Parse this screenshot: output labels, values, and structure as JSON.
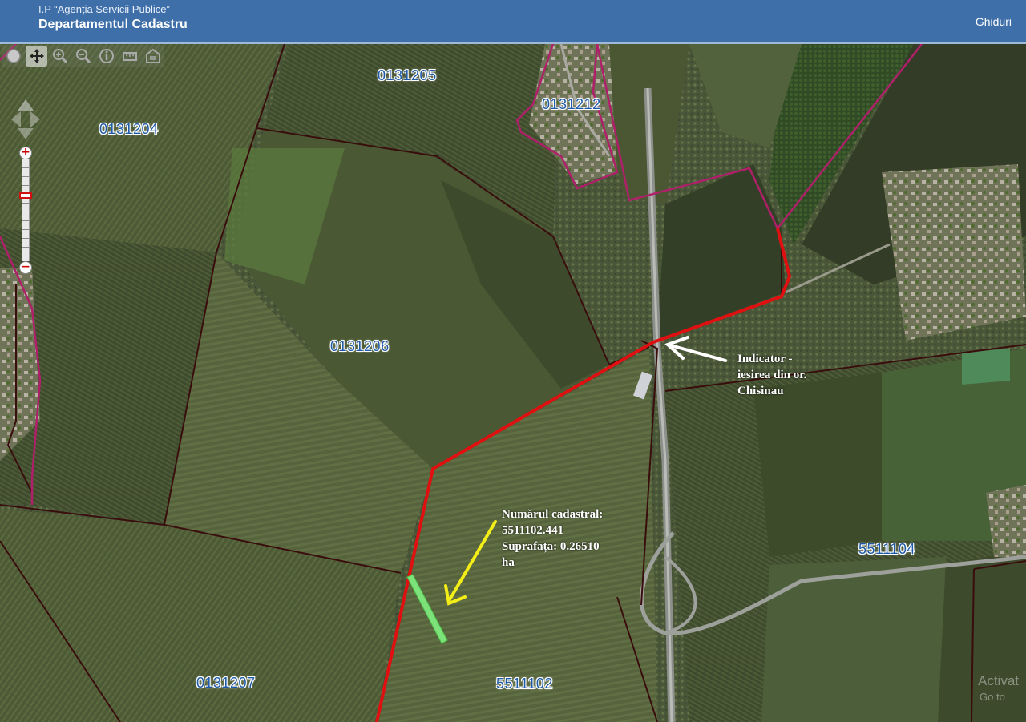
{
  "header": {
    "organization": "I.P “Agenția Servicii Publice”",
    "department": "Departamentul Cadastru",
    "guides_link": "Ghiduri"
  },
  "toolbar": {
    "tools": [
      {
        "icon": "globe-icon",
        "active": false
      },
      {
        "icon": "pan-icon",
        "active": true
      },
      {
        "icon": "zoom-in-icon",
        "active": false
      },
      {
        "icon": "zoom-out-icon",
        "active": false
      },
      {
        "icon": "info-icon",
        "active": false
      },
      {
        "icon": "measure-icon",
        "active": false
      },
      {
        "icon": "building-icon",
        "active": false
      }
    ]
  },
  "zoom": {
    "plus": "+",
    "minus": "−"
  },
  "parcels": {
    "p0131205": "0131205",
    "p0131212": "0131212",
    "p0131204": "0131204",
    "p0131206": "0131206",
    "p0131207": "0131207",
    "p5511102": "5511102",
    "p5511104": "5511104"
  },
  "annotations": {
    "indicator": {
      "line1": "Indicator -",
      "line2": "iesirea din or.",
      "line3": "Chisinau"
    },
    "parcel_info": {
      "line1": "Numărul cadastral:",
      "line2": "5511102.441",
      "line3": "Suprafața: 0.26510",
      "line4": "ha"
    }
  },
  "watermark": {
    "line1": "Activat",
    "line2": "Go to"
  },
  "colors": {
    "header_bg": "#3f6fa8",
    "boundary_dark": "#3a0d0d",
    "boundary_magenta": "#b0206a",
    "route_red": "#e01010",
    "arrow_yellow": "#f4ee18",
    "parcel_green": "#7ee27a",
    "parcel_label": "#1e5aa8"
  }
}
